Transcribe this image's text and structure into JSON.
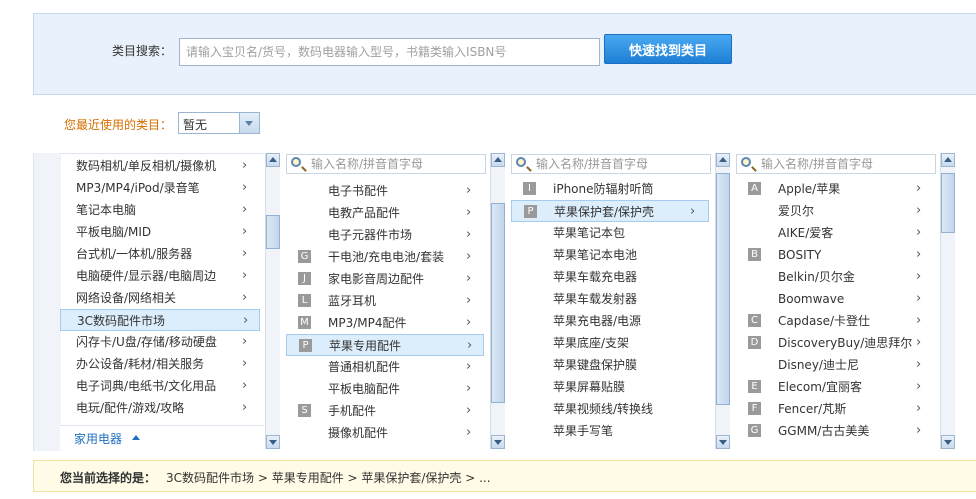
{
  "search": {
    "label": "类目搜索：",
    "placeholder": "请输入宝贝名/货号，数码电器输入型号，书籍类输入ISBN号",
    "button": "快速找到类目"
  },
  "recent": {
    "label": "您最近使用的类目：",
    "value": "暂无"
  },
  "filter_placeholder": "输入名称/拼音首字母",
  "column1": {
    "items": [
      {
        "label": "数码相机/单反相机/摄像机"
      },
      {
        "label": "MP3/MP4/iPod/录音笔"
      },
      {
        "label": "笔记本电脑"
      },
      {
        "label": "平板电脑/MID"
      },
      {
        "label": "台式机/一体机/服务器"
      },
      {
        "label": "电脑硬件/显示器/电脑周边"
      },
      {
        "label": "网络设备/网络相关"
      },
      {
        "label": "3C数码配件市场",
        "selected": true
      },
      {
        "label": "闪存卡/U盘/存储/移动硬盘"
      },
      {
        "label": "办公设备/耗材/相关服务"
      },
      {
        "label": "电子词典/电纸书/文化用品"
      },
      {
        "label": "电玩/配件/游戏/攻略"
      }
    ],
    "footer_link": "家用电器"
  },
  "column2": {
    "items": [
      {
        "badge": "",
        "label": "电子书配件"
      },
      {
        "badge": "",
        "label": "电教产品配件"
      },
      {
        "badge": "",
        "label": "电子元器件市场"
      },
      {
        "badge": "G",
        "label": "干电池/充电电池/套装"
      },
      {
        "badge": "J",
        "label": "家电影音周边配件"
      },
      {
        "badge": "L",
        "label": "蓝牙耳机"
      },
      {
        "badge": "M",
        "label": "MP3/MP4配件"
      },
      {
        "badge": "P",
        "label": "苹果专用配件",
        "selected": true
      },
      {
        "badge": "",
        "label": "普通相机配件"
      },
      {
        "badge": "",
        "label": "平板电脑配件"
      },
      {
        "badge": "S",
        "label": "手机配件"
      },
      {
        "badge": "",
        "label": "摄像机配件"
      }
    ]
  },
  "column3": {
    "items": [
      {
        "badge": "I",
        "label": "iPhone防辐射听筒",
        "chev": false
      },
      {
        "badge": "P",
        "label": "苹果保护套/保护壳",
        "selected": true,
        "chev": true
      },
      {
        "badge": "",
        "label": "苹果笔记本包",
        "chev": false
      },
      {
        "badge": "",
        "label": "苹果笔记本电池",
        "chev": false
      },
      {
        "badge": "",
        "label": "苹果车载充电器",
        "chev": false
      },
      {
        "badge": "",
        "label": "苹果车载发射器",
        "chev": false
      },
      {
        "badge": "",
        "label": "苹果充电器/电源",
        "chev": false
      },
      {
        "badge": "",
        "label": "苹果底座/支架",
        "chev": false
      },
      {
        "badge": "",
        "label": "苹果键盘保护膜",
        "chev": false
      },
      {
        "badge": "",
        "label": "苹果屏幕贴膜",
        "chev": false
      },
      {
        "badge": "",
        "label": "苹果视频线/转换线",
        "chev": false
      },
      {
        "badge": "",
        "label": "苹果手写笔",
        "chev": false
      }
    ]
  },
  "column4": {
    "items": [
      {
        "badge": "A",
        "label": "Apple/苹果"
      },
      {
        "badge": "",
        "label": "爱贝尔"
      },
      {
        "badge": "",
        "label": "AIKE/爱客"
      },
      {
        "badge": "B",
        "label": "BOSITY"
      },
      {
        "badge": "",
        "label": "Belkin/贝尔金"
      },
      {
        "badge": "",
        "label": "Boomwave"
      },
      {
        "badge": "C",
        "label": "Capdase/卡登仕"
      },
      {
        "badge": "D",
        "label": "DiscoveryBuy/迪思拜尔"
      },
      {
        "badge": "",
        "label": "Disney/迪士尼"
      },
      {
        "badge": "E",
        "label": "Elecom/宜丽客"
      },
      {
        "badge": "F",
        "label": "Fencer/芃斯"
      },
      {
        "badge": "G",
        "label": "GGMM/古古美美"
      }
    ]
  },
  "selection": {
    "label": "您当前选择的是：",
    "path": "3C数码配件市场 > 苹果专用配件 > 苹果保护套/保护壳 > ..."
  }
}
